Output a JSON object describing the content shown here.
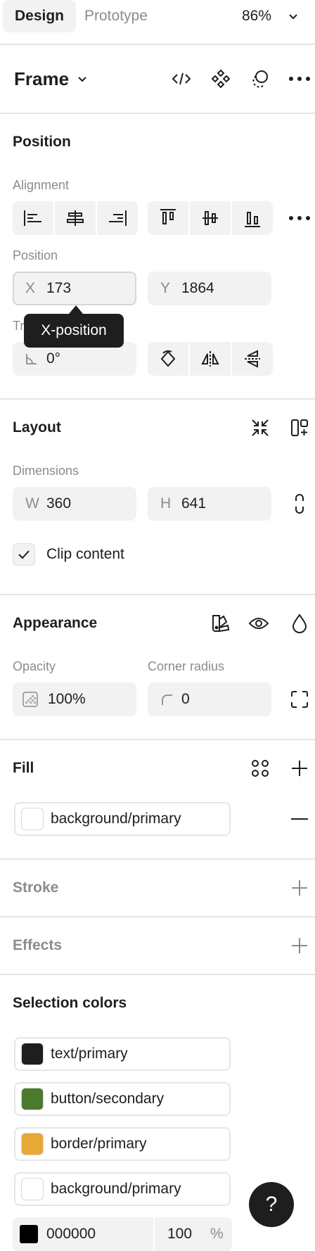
{
  "tabs": {
    "design": "Design",
    "prototype": "Prototype"
  },
  "zoom": "86%",
  "frame": {
    "title": "Frame"
  },
  "position": {
    "title": "Position",
    "alignment_label": "Alignment",
    "position_label": "Position",
    "x_prefix": "X",
    "x_value": "173",
    "y_prefix": "Y",
    "y_value": "1864",
    "transform_label_partial": "Tr",
    "rotation_value": "0°",
    "tooltip": "X-position"
  },
  "layout": {
    "title": "Layout",
    "dimensions_label": "Dimensions",
    "w_prefix": "W",
    "w_value": "360",
    "h_prefix": "H",
    "h_value": "641",
    "clip_label": "Clip content",
    "clip_checked": true
  },
  "appearance": {
    "title": "Appearance",
    "opacity_label": "Opacity",
    "opacity_value": "100%",
    "radius_label": "Corner radius",
    "radius_value": "0"
  },
  "fill": {
    "title": "Fill",
    "item": {
      "name": "background/primary",
      "color": "#ffffff"
    }
  },
  "stroke": {
    "title": "Stroke"
  },
  "effects": {
    "title": "Effects"
  },
  "selection_colors": {
    "title": "Selection colors",
    "items": [
      {
        "name": "text/primary",
        "color": "#1e1e1e"
      },
      {
        "name": "button/secondary",
        "color": "#4a7a2c"
      },
      {
        "name": "border/primary",
        "color": "#e8a838"
      },
      {
        "name": "background/primary",
        "color": "#ffffff"
      }
    ],
    "hex": {
      "value": "000000",
      "opacity": "100",
      "unit": "%",
      "color": "#000000"
    }
  },
  "help": "?"
}
